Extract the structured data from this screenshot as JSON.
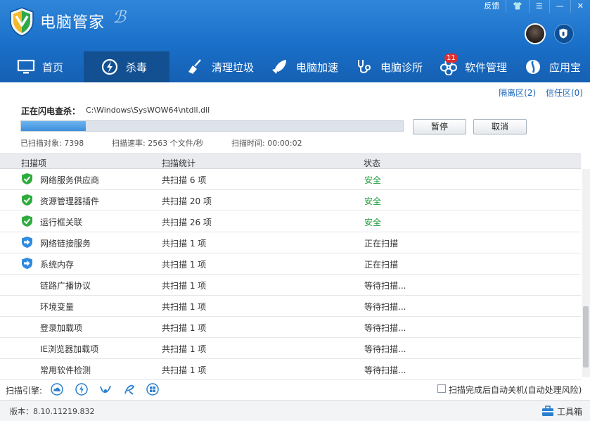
{
  "app": {
    "title": "电脑管家"
  },
  "window_controls": [
    "反馈",
    "👕",
    "☰",
    "—",
    "✕"
  ],
  "nav": [
    {
      "label": "首页",
      "icon": "monitor-icon"
    },
    {
      "label": "杀毒",
      "icon": "antivirus-icon",
      "active": true
    },
    {
      "label": "清理垃圾",
      "icon": "broom-icon"
    },
    {
      "label": "电脑加速",
      "icon": "rocket-icon"
    },
    {
      "label": "电脑诊所",
      "icon": "stethoscope-icon"
    },
    {
      "label": "软件管理",
      "icon": "software-icon",
      "badge": "11"
    },
    {
      "label": "应用宝",
      "icon": "appstore-icon"
    }
  ],
  "links": {
    "quarantine": "隔离区(2)",
    "trust": "信任区(0)"
  },
  "scan": {
    "label": "正在闪电查杀：",
    "path": "C:\\Windows\\SysWOW64\\ntdll.dll",
    "progress": 0.17,
    "pause": "暂停",
    "cancel": "取消",
    "scanned": "已扫描对象: 7398",
    "speed": "扫描速率: 2563 个文件/秒",
    "time": "扫描时间: 00:00:02"
  },
  "table": {
    "headers": [
      "扫描项",
      "扫描统计",
      "状态"
    ],
    "rows": [
      {
        "name": "网络服务供应商",
        "count": "共扫描 6 项",
        "status": "安全",
        "state": "safe"
      },
      {
        "name": "资源管理器插件",
        "count": "共扫描 20 项",
        "status": "安全",
        "state": "safe"
      },
      {
        "name": "运行框关联",
        "count": "共扫描 26 项",
        "status": "安全",
        "state": "safe"
      },
      {
        "name": "网络链接服务",
        "count": "共扫描 1 项",
        "status": "正在扫描",
        "state": "scanning"
      },
      {
        "name": "系统内存",
        "count": "共扫描 1 项",
        "status": "正在扫描",
        "state": "scanning"
      },
      {
        "name": "链路广播协议",
        "count": "共扫描 1 项",
        "status": "等待扫描...",
        "state": "waiting"
      },
      {
        "name": "环境变量",
        "count": "共扫描 1 项",
        "status": "等待扫描...",
        "state": "waiting"
      },
      {
        "name": "登录加载项",
        "count": "共扫描 1 项",
        "status": "等待扫描...",
        "state": "waiting"
      },
      {
        "name": "IE浏览器加载项",
        "count": "共扫描 1 项",
        "status": "等待扫描...",
        "state": "waiting"
      },
      {
        "name": "常用软件检测",
        "count": "共扫描 1 项",
        "status": "等待扫描...",
        "state": "waiting"
      }
    ]
  },
  "engines": {
    "label": "扫描引擎:",
    "items": [
      "cloud-engine-icon",
      "antivirus-engine-icon",
      "repair-engine-icon",
      "heuristic-engine-icon",
      "system-engine-icon"
    ]
  },
  "auto_option": {
    "label": "扫描完成后自动关机(自动处理风险)",
    "checked": false
  },
  "footer": {
    "version": "版本：8.10.11219.832",
    "toolbox": "工具箱"
  },
  "colors": {
    "header": "#1a6fc8",
    "nav_active": "#135092",
    "safe": "#1e9c3a",
    "badge": "#e22d2d"
  }
}
